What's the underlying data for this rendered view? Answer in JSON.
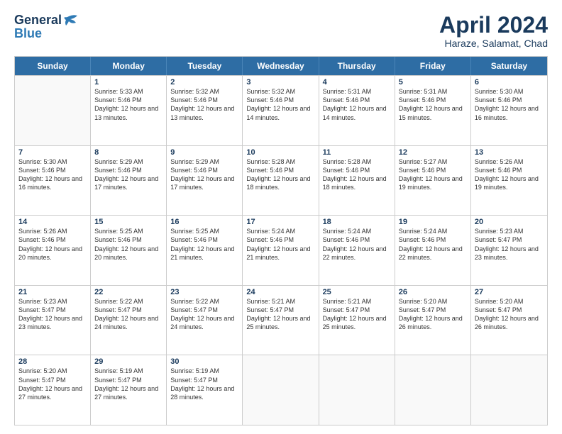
{
  "logo": {
    "general": "General",
    "blue": "Blue"
  },
  "title": "April 2024",
  "subtitle": "Haraze, Salamat, Chad",
  "header": {
    "days": [
      "Sunday",
      "Monday",
      "Tuesday",
      "Wednesday",
      "Thursday",
      "Friday",
      "Saturday"
    ]
  },
  "rows": [
    [
      {
        "day": "",
        "empty": true
      },
      {
        "day": "1",
        "sunrise": "Sunrise: 5:33 AM",
        "sunset": "Sunset: 5:46 PM",
        "daylight": "Daylight: 12 hours and 13 minutes."
      },
      {
        "day": "2",
        "sunrise": "Sunrise: 5:32 AM",
        "sunset": "Sunset: 5:46 PM",
        "daylight": "Daylight: 12 hours and 13 minutes."
      },
      {
        "day": "3",
        "sunrise": "Sunrise: 5:32 AM",
        "sunset": "Sunset: 5:46 PM",
        "daylight": "Daylight: 12 hours and 14 minutes."
      },
      {
        "day": "4",
        "sunrise": "Sunrise: 5:31 AM",
        "sunset": "Sunset: 5:46 PM",
        "daylight": "Daylight: 12 hours and 14 minutes."
      },
      {
        "day": "5",
        "sunrise": "Sunrise: 5:31 AM",
        "sunset": "Sunset: 5:46 PM",
        "daylight": "Daylight: 12 hours and 15 minutes."
      },
      {
        "day": "6",
        "sunrise": "Sunrise: 5:30 AM",
        "sunset": "Sunset: 5:46 PM",
        "daylight": "Daylight: 12 hours and 16 minutes."
      }
    ],
    [
      {
        "day": "7",
        "sunrise": "Sunrise: 5:30 AM",
        "sunset": "Sunset: 5:46 PM",
        "daylight": "Daylight: 12 hours and 16 minutes."
      },
      {
        "day": "8",
        "sunrise": "Sunrise: 5:29 AM",
        "sunset": "Sunset: 5:46 PM",
        "daylight": "Daylight: 12 hours and 17 minutes."
      },
      {
        "day": "9",
        "sunrise": "Sunrise: 5:29 AM",
        "sunset": "Sunset: 5:46 PM",
        "daylight": "Daylight: 12 hours and 17 minutes."
      },
      {
        "day": "10",
        "sunrise": "Sunrise: 5:28 AM",
        "sunset": "Sunset: 5:46 PM",
        "daylight": "Daylight: 12 hours and 18 minutes."
      },
      {
        "day": "11",
        "sunrise": "Sunrise: 5:28 AM",
        "sunset": "Sunset: 5:46 PM",
        "daylight": "Daylight: 12 hours and 18 minutes."
      },
      {
        "day": "12",
        "sunrise": "Sunrise: 5:27 AM",
        "sunset": "Sunset: 5:46 PM",
        "daylight": "Daylight: 12 hours and 19 minutes."
      },
      {
        "day": "13",
        "sunrise": "Sunrise: 5:26 AM",
        "sunset": "Sunset: 5:46 PM",
        "daylight": "Daylight: 12 hours and 19 minutes."
      }
    ],
    [
      {
        "day": "14",
        "sunrise": "Sunrise: 5:26 AM",
        "sunset": "Sunset: 5:46 PM",
        "daylight": "Daylight: 12 hours and 20 minutes."
      },
      {
        "day": "15",
        "sunrise": "Sunrise: 5:25 AM",
        "sunset": "Sunset: 5:46 PM",
        "daylight": "Daylight: 12 hours and 20 minutes."
      },
      {
        "day": "16",
        "sunrise": "Sunrise: 5:25 AM",
        "sunset": "Sunset: 5:46 PM",
        "daylight": "Daylight: 12 hours and 21 minutes."
      },
      {
        "day": "17",
        "sunrise": "Sunrise: 5:24 AM",
        "sunset": "Sunset: 5:46 PM",
        "daylight": "Daylight: 12 hours and 21 minutes."
      },
      {
        "day": "18",
        "sunrise": "Sunrise: 5:24 AM",
        "sunset": "Sunset: 5:46 PM",
        "daylight": "Daylight: 12 hours and 22 minutes."
      },
      {
        "day": "19",
        "sunrise": "Sunrise: 5:24 AM",
        "sunset": "Sunset: 5:46 PM",
        "daylight": "Daylight: 12 hours and 22 minutes."
      },
      {
        "day": "20",
        "sunrise": "Sunrise: 5:23 AM",
        "sunset": "Sunset: 5:47 PM",
        "daylight": "Daylight: 12 hours and 23 minutes."
      }
    ],
    [
      {
        "day": "21",
        "sunrise": "Sunrise: 5:23 AM",
        "sunset": "Sunset: 5:47 PM",
        "daylight": "Daylight: 12 hours and 23 minutes."
      },
      {
        "day": "22",
        "sunrise": "Sunrise: 5:22 AM",
        "sunset": "Sunset: 5:47 PM",
        "daylight": "Daylight: 12 hours and 24 minutes."
      },
      {
        "day": "23",
        "sunrise": "Sunrise: 5:22 AM",
        "sunset": "Sunset: 5:47 PM",
        "daylight": "Daylight: 12 hours and 24 minutes."
      },
      {
        "day": "24",
        "sunrise": "Sunrise: 5:21 AM",
        "sunset": "Sunset: 5:47 PM",
        "daylight": "Daylight: 12 hours and 25 minutes."
      },
      {
        "day": "25",
        "sunrise": "Sunrise: 5:21 AM",
        "sunset": "Sunset: 5:47 PM",
        "daylight": "Daylight: 12 hours and 25 minutes."
      },
      {
        "day": "26",
        "sunrise": "Sunrise: 5:20 AM",
        "sunset": "Sunset: 5:47 PM",
        "daylight": "Daylight: 12 hours and 26 minutes."
      },
      {
        "day": "27",
        "sunrise": "Sunrise: 5:20 AM",
        "sunset": "Sunset: 5:47 PM",
        "daylight": "Daylight: 12 hours and 26 minutes."
      }
    ],
    [
      {
        "day": "28",
        "sunrise": "Sunrise: 5:20 AM",
        "sunset": "Sunset: 5:47 PM",
        "daylight": "Daylight: 12 hours and 27 minutes."
      },
      {
        "day": "29",
        "sunrise": "Sunrise: 5:19 AM",
        "sunset": "Sunset: 5:47 PM",
        "daylight": "Daylight: 12 hours and 27 minutes."
      },
      {
        "day": "30",
        "sunrise": "Sunrise: 5:19 AM",
        "sunset": "Sunset: 5:47 PM",
        "daylight": "Daylight: 12 hours and 28 minutes."
      },
      {
        "day": "",
        "empty": true
      },
      {
        "day": "",
        "empty": true
      },
      {
        "day": "",
        "empty": true
      },
      {
        "day": "",
        "empty": true
      }
    ]
  ]
}
